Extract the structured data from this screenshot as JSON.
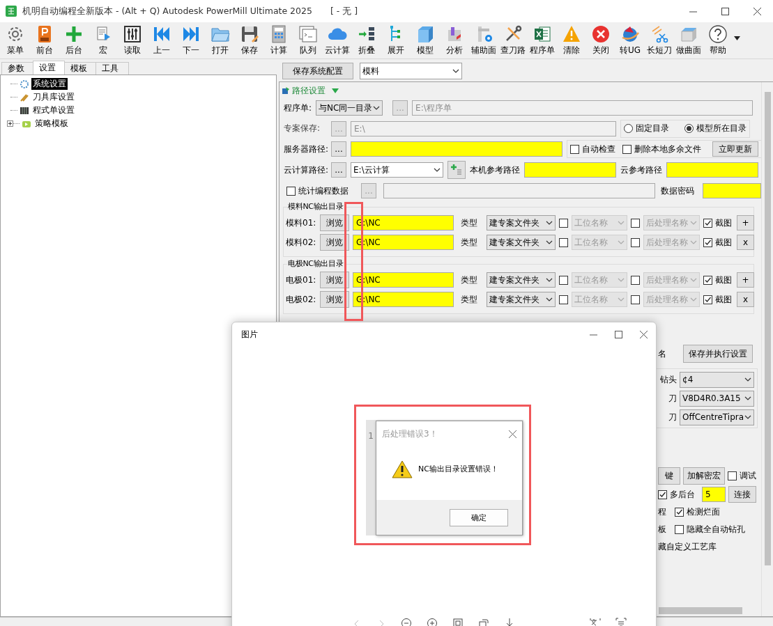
{
  "window": {
    "title": "机明自动编程全新版本 - (Alt + Q) Autodesk PowerMill Ultimate 2025",
    "document": "[  - 无 ]"
  },
  "toolbar": [
    {
      "label": "菜单"
    },
    {
      "label": "前台"
    },
    {
      "label": "后台"
    },
    {
      "label": "宏"
    },
    {
      "label": "读取"
    },
    {
      "label": "上一"
    },
    {
      "label": "下一"
    },
    {
      "label": "打开"
    },
    {
      "label": "保存"
    },
    {
      "label": "计算"
    },
    {
      "label": "队列"
    },
    {
      "label": "云计算"
    },
    {
      "label": "折叠"
    },
    {
      "label": "展开"
    },
    {
      "label": "模型"
    },
    {
      "label": "分析"
    },
    {
      "label": "辅助面"
    },
    {
      "label": "查刀路"
    },
    {
      "label": "程序单"
    },
    {
      "label": "清除"
    },
    {
      "label": "关闭"
    },
    {
      "label": "转UG"
    },
    {
      "label": "长短刀"
    },
    {
      "label": "做曲面"
    },
    {
      "label": "帮助"
    }
  ],
  "left_tabs": [
    {
      "label": "参数",
      "selected": false
    },
    {
      "label": "设置",
      "selected": true
    },
    {
      "label": "模板",
      "selected": false
    },
    {
      "label": "工具",
      "selected": false
    }
  ],
  "tree": [
    {
      "label": "系统设置",
      "selected": true
    },
    {
      "label": "刀具库设置",
      "selected": false
    },
    {
      "label": "程式单设置",
      "selected": false
    },
    {
      "label": "策略模板",
      "selected": false,
      "expanded": false
    }
  ],
  "settings": {
    "save_button": "保存系统配置",
    "profile": "模料",
    "section": "路径设置",
    "program_sheet": {
      "label": "程序单:",
      "select": "与NC同一目录",
      "browse": {
        "label": "...",
        "disabled": true
      },
      "path": {
        "value": "E:\\程序单",
        "disabled": true
      }
    },
    "project_save": {
      "label": "专案保存:",
      "browse": {
        "label": "...",
        "disabled": true
      },
      "path": {
        "value": "E:\\",
        "disabled": true
      },
      "radios": [
        {
          "label": "固定目录",
          "selected": false
        },
        {
          "label": "模型所在目录",
          "selected": true
        }
      ]
    },
    "server": {
      "label": "服务器路径:",
      "browse": {
        "label": "...",
        "disabled": false
      },
      "checks": [
        {
          "label": "自动检查",
          "checked": false
        },
        {
          "label": "删除本地多余文件",
          "checked": false
        }
      ],
      "update_button": "立即更新"
    },
    "cloud": {
      "label": "云计算路径:",
      "browse": {
        "label": "...",
        "disabled": false
      },
      "select": "E:\\云计算",
      "local_label": "本机参考路径",
      "cloud_label": "云参考路径"
    },
    "stats": {
      "label": "统计编程数据",
      "checked": false,
      "browse": {
        "label": "...",
        "disabled": true
      },
      "password_label": "数据密码"
    },
    "nc_groups": [
      {
        "title": "模料NC输出目录",
        "rows": [
          {
            "label": "模料01:",
            "browse": "浏览",
            "path": "G:\\NC",
            "type_label": "类型",
            "type": "建专案文件夹",
            "station_checked": false,
            "station": "工位名称",
            "post_checked": false,
            "post": "后处理名称",
            "shot_checked": true,
            "shot": "截图",
            "action": "+"
          },
          {
            "label": "模料02:",
            "browse": "浏览",
            "path": "G:\\NC",
            "type_label": "类型",
            "type": "建专案文件夹",
            "station_checked": false,
            "station": "工位名称",
            "post_checked": false,
            "post": "后处理名称",
            "shot_checked": true,
            "shot": "截图",
            "action": "x"
          }
        ]
      },
      {
        "title": "电极NC输出目录",
        "rows": [
          {
            "label": "电极01:",
            "browse": "浏览",
            "path": "G:\\NC",
            "type_label": "类型",
            "type": "建专案文件夹",
            "station_checked": false,
            "station": "工位名称",
            "post_checked": false,
            "post": "后处理名称",
            "shot_checked": true,
            "shot": "截图",
            "action": "+"
          },
          {
            "label": "电极02:",
            "browse": "浏览",
            "path": "G:\\NC",
            "type_label": "类型",
            "type": "建专案文件夹",
            "station_checked": false,
            "station": "工位名称",
            "post_checked": false,
            "post": "后处理名称",
            "shot_checked": true,
            "shot": "截图",
            "action": "x"
          }
        ]
      }
    ]
  },
  "lower": {
    "name_fragment": "名",
    "exec_button": "保存并执行设置",
    "tools": [
      {
        "label": "钻头",
        "value": "¢4"
      },
      {
        "label": "刀",
        "value": "V8D4R0.3A15"
      },
      {
        "label": "刀",
        "value": "OffCentreTipra"
      }
    ],
    "key_button": "键",
    "macro_button": "加解密宏",
    "debug": {
      "label": "调试",
      "checked": false
    },
    "multi": {
      "label": "多后台",
      "checked": true,
      "value": "5",
      "button": "连接"
    },
    "process_fragment": "程",
    "check_face": {
      "label": "检测烂面",
      "checked": true
    },
    "board_fragment": "板",
    "hide_drill": {
      "label": "隐藏全自动钻孔",
      "checked": false
    },
    "library_fragment": "藏自定义工艺库"
  },
  "viewer": {
    "title": "图片",
    "behind_text": "1",
    "dialog": {
      "title": "后处理错误3！",
      "message": "NC输出目录设置错误！",
      "ok": "确定"
    }
  }
}
